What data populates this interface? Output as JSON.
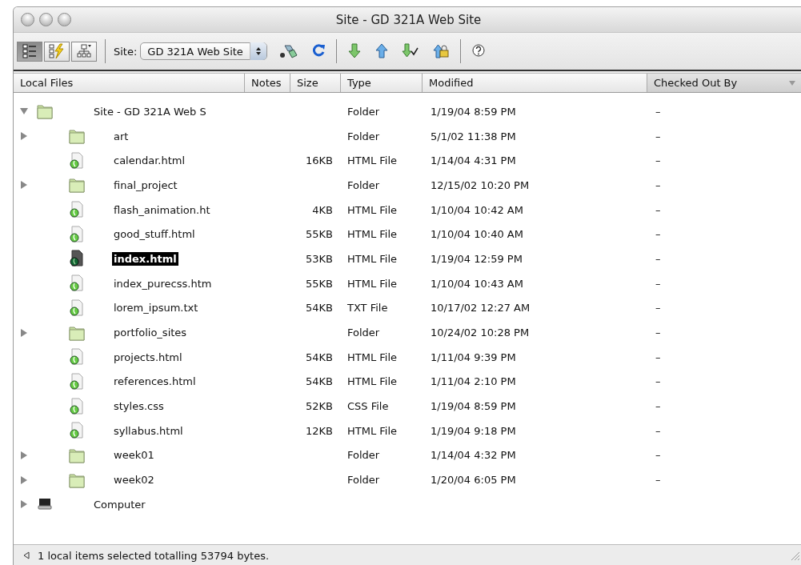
{
  "window": {
    "title": "Site - GD 321A Web Site"
  },
  "toolbar": {
    "view_buttons": [
      {
        "kind": "files",
        "selected": true
      },
      {
        "kind": "testing",
        "selected": false
      },
      {
        "kind": "map",
        "selected": false
      }
    ],
    "site_label": "Site:",
    "site_select": "GD 321A Web Site",
    "tools": [
      {
        "kind": "connect"
      },
      {
        "kind": "refresh"
      },
      {
        "kind": "separator"
      },
      {
        "kind": "get"
      },
      {
        "kind": "put"
      },
      {
        "kind": "checkout"
      },
      {
        "kind": "checkin"
      },
      {
        "kind": "separator"
      },
      {
        "kind": "help"
      }
    ]
  },
  "table": {
    "columns": [
      {
        "label": "Local Files",
        "sorted": false
      },
      {
        "label": "Notes",
        "sorted": false
      },
      {
        "label": "Size",
        "sorted": false
      },
      {
        "label": "Type",
        "sorted": false
      },
      {
        "label": "Modified",
        "sorted": false
      },
      {
        "label": "Checked Out By",
        "sorted": true
      }
    ],
    "rows": [
      {
        "kind": "folder",
        "name": "Site - GD 321A Web S",
        "type": "Folder",
        "modified": "1/19/04 8:59 PM",
        "checked_out_by": "–",
        "expanded": true,
        "selected": false,
        "children": [
          {
            "kind": "folder",
            "name": "art",
            "type": "Folder",
            "modified": "5/1/02 11:38 PM",
            "checked_out_by": "–",
            "expanded": false,
            "selected": false
          },
          {
            "kind": "file",
            "name": "calendar.html",
            "size": "16KB",
            "type": "HTML File",
            "modified": "1/14/04 4:31 PM",
            "checked_out_by": "–",
            "selected": false
          },
          {
            "kind": "folder",
            "name": "final_project",
            "type": "Folder",
            "modified": "12/15/02 10:20 PM",
            "checked_out_by": "–",
            "expanded": false,
            "selected": false
          },
          {
            "kind": "file",
            "name": "flash_animation.ht",
            "size": "4KB",
            "type": "HTML File",
            "modified": "1/10/04 10:42 AM",
            "checked_out_by": "–",
            "selected": false
          },
          {
            "kind": "file",
            "name": "good_stuff.html",
            "size": "55KB",
            "type": "HTML File",
            "modified": "1/10/04 10:40 AM",
            "checked_out_by": "–",
            "selected": false
          },
          {
            "kind": "file",
            "name": "index.html",
            "size": "53KB",
            "type": "HTML File",
            "modified": "1/19/04 12:59 PM",
            "checked_out_by": "–",
            "selected": true
          },
          {
            "kind": "file",
            "name": "index_purecss.htm",
            "size": "55KB",
            "type": "HTML File",
            "modified": "1/10/04 10:43 AM",
            "checked_out_by": "–",
            "selected": false
          },
          {
            "kind": "file",
            "name": "lorem_ipsum.txt",
            "size": "54KB",
            "type": "TXT File",
            "modified": "10/17/02 12:27 AM",
            "checked_out_by": "–",
            "selected": false
          },
          {
            "kind": "folder",
            "name": "portfolio_sites",
            "type": "Folder",
            "modified": "10/24/02 10:28 PM",
            "checked_out_by": "–",
            "expanded": false,
            "selected": false
          },
          {
            "kind": "file",
            "name": "projects.html",
            "size": "54KB",
            "type": "HTML File",
            "modified": "1/11/04 9:39 PM",
            "checked_out_by": "–",
            "selected": false
          },
          {
            "kind": "file",
            "name": "references.html",
            "size": "54KB",
            "type": "HTML File",
            "modified": "1/11/04 2:10 PM",
            "checked_out_by": "–",
            "selected": false
          },
          {
            "kind": "file",
            "name": "styles.css",
            "size": "52KB",
            "type": "CSS File",
            "modified": "1/19/04 8:59 PM",
            "checked_out_by": "–",
            "selected": false
          },
          {
            "kind": "file",
            "name": "syllabus.html",
            "size": "12KB",
            "type": "HTML File",
            "modified": "1/19/04 9:18 PM",
            "checked_out_by": "–",
            "selected": false
          },
          {
            "kind": "folder",
            "name": "week01",
            "type": "Folder",
            "modified": "1/14/04 4:32 PM",
            "checked_out_by": "–",
            "expanded": false,
            "selected": false
          },
          {
            "kind": "folder",
            "name": "week02",
            "type": "Folder",
            "modified": "1/20/04 6:05 PM",
            "checked_out_by": "–",
            "expanded": false,
            "selected": false
          }
        ]
      },
      {
        "kind": "computer",
        "name": "Computer",
        "expanded": false,
        "selected": false
      }
    ]
  },
  "status_bar": {
    "text": "1 local items selected totalling 53794 bytes."
  }
}
